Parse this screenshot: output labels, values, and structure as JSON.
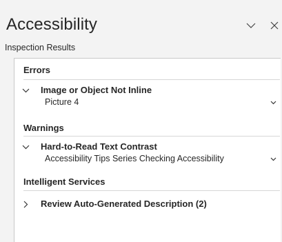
{
  "pane": {
    "title": "Accessibility",
    "subtitle": "Inspection Results",
    "options_icon": "chevron-down-icon",
    "close_icon": "close-icon"
  },
  "categories": [
    {
      "label": "Errors",
      "issues": [
        {
          "title": "Image or Object Not Inline",
          "object": "Picture 4",
          "expanded": true
        }
      ]
    },
    {
      "label": "Warnings",
      "issues": [
        {
          "title": "Hard-to-Read Text Contrast",
          "object": "Accessibility Tips Series Checking Accessibility",
          "expanded": true
        }
      ]
    },
    {
      "label": "Intelligent Services",
      "issues": [
        {
          "title": "Review Auto-Generated Description (2)",
          "object": "",
          "expanded": false
        }
      ]
    }
  ],
  "colors": {
    "pane_background": "#f3f3f3",
    "results_background": "#ffffff",
    "border": "#c8c8c8",
    "text": "#262626"
  }
}
